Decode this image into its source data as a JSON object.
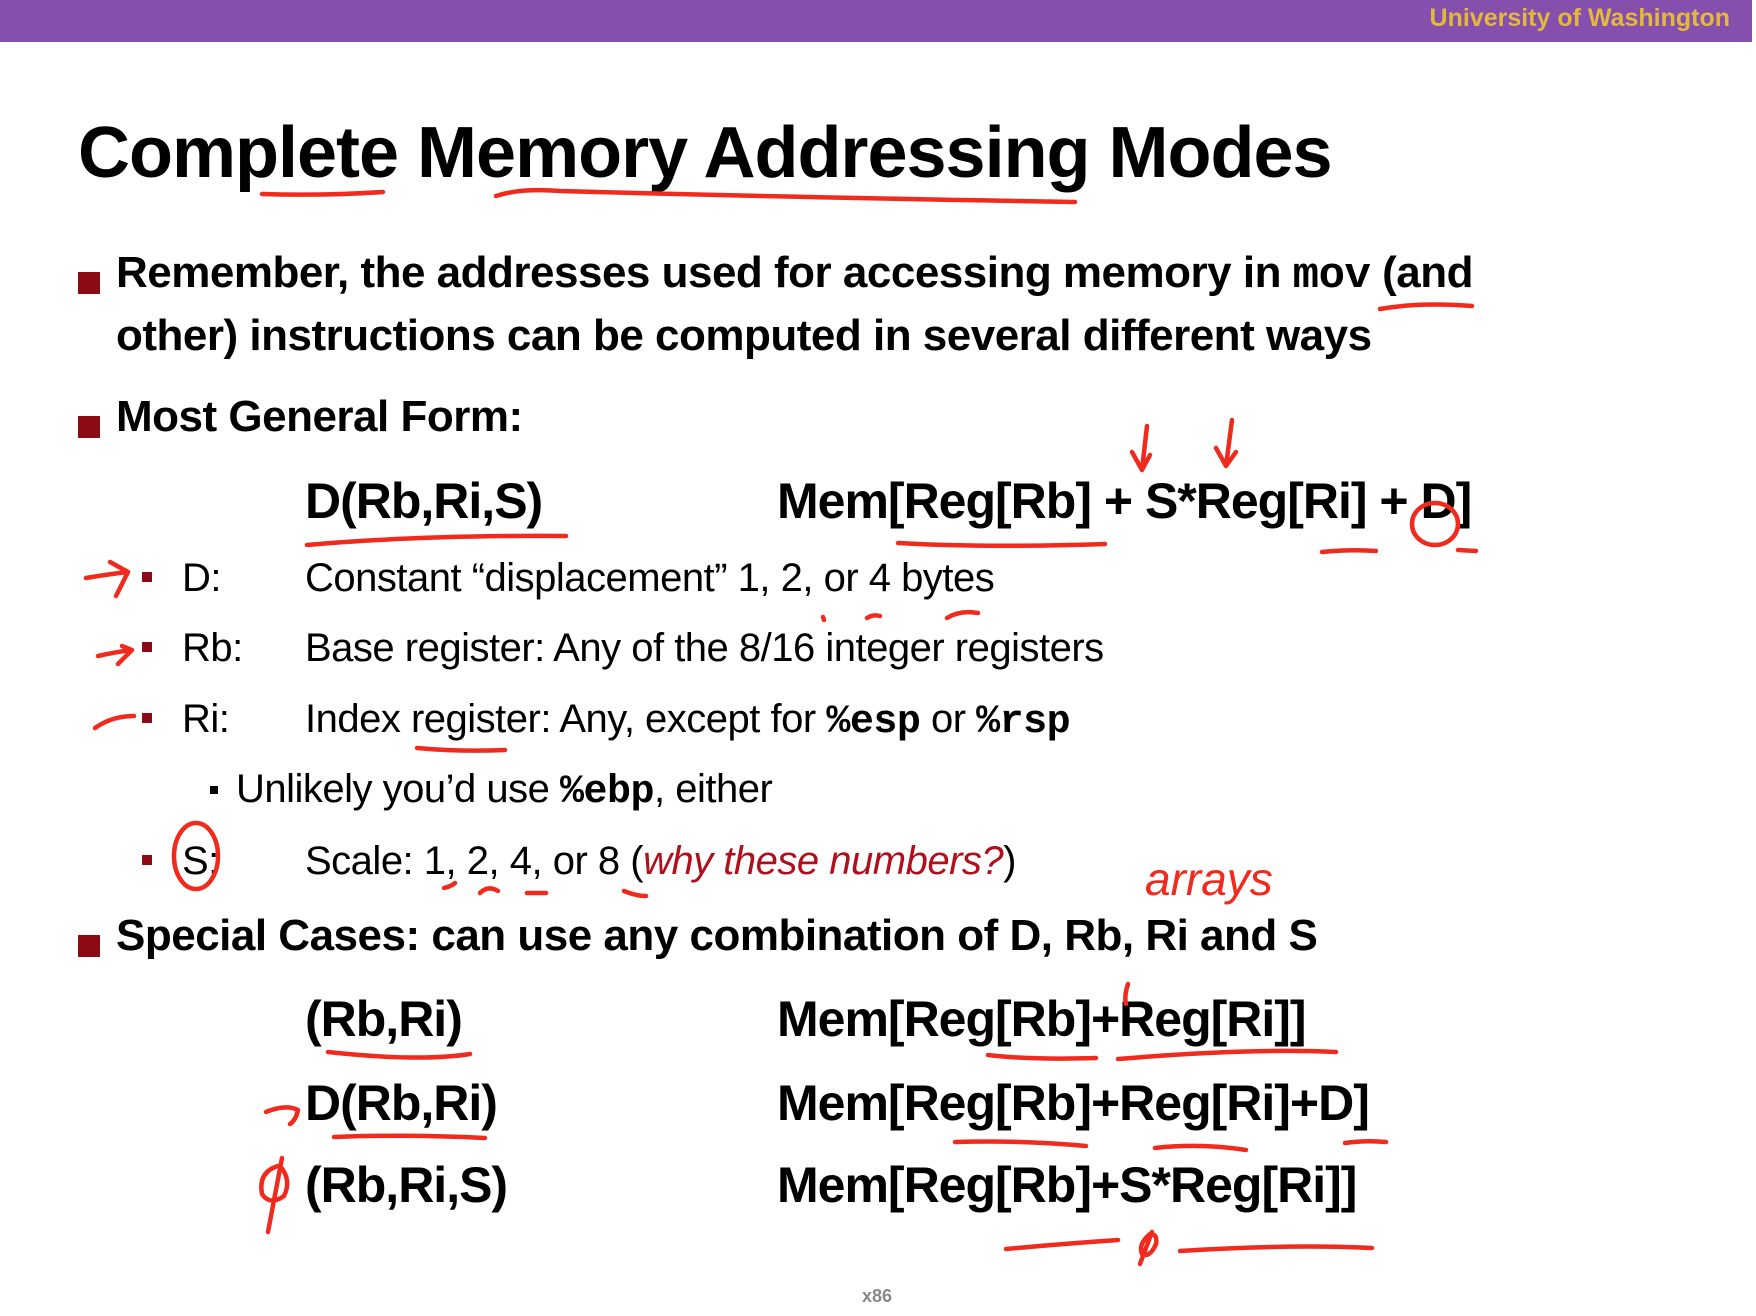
{
  "header": {
    "institution": "University of Washington"
  },
  "slide": {
    "title": "Complete Memory Addressing Modes",
    "bullet1": {
      "line1_pre": "Remember, the addresses used for accessing memory in ",
      "line1_code": "mov",
      "line1_post": " (and",
      "line2": "other) instructions can be computed in several different ways"
    },
    "general": {
      "heading": "Most General Form:",
      "syntax": "D(Rb,Ri,S)",
      "meaning": "Mem[Reg[Rb] + S*Reg[Ri] + D]"
    },
    "components": [
      {
        "label": "D:",
        "desc": "Constant “displacement” 1, 2, or 4 bytes"
      },
      {
        "label": "Rb:",
        "desc": "Base register: Any of the 8/16 integer registers"
      },
      {
        "label": "Ri:",
        "desc_pre": "Index register: Any, except for ",
        "code1": "%esp",
        "mid": " or ",
        "code2": "%rsp"
      },
      {
        "label": "S:",
        "desc_pre": "Scale: 1, 2, 4, or 8 (",
        "desc_italic": "why these numbers?",
        "desc_post": ")"
      }
    ],
    "sub_note": {
      "pre": "Unlikely you’d use ",
      "code": "%ebp",
      "post": ", either"
    },
    "special": {
      "heading": "Special Cases: can use any combination of D, Rb, Ri and S",
      "cases": [
        {
          "syntax": "(Rb,Ri)",
          "meaning": "Mem[Reg[Rb]+Reg[Ri]]"
        },
        {
          "syntax": "D(Rb,Ri)",
          "meaning": "Mem[Reg[Rb]+Reg[Ri]+D]"
        },
        {
          "syntax": "(Rb,Ri,S)",
          "meaning": "Mem[Reg[Rb]+S*Reg[Ri]]"
        }
      ]
    },
    "annotations": {
      "arrays_note": "arrays",
      "null_mark": "ϕ"
    },
    "footer": "x86"
  },
  "colors": {
    "banner": "#854fae",
    "banner_text": "#e3b83c",
    "bullet": "#8b0a14",
    "ink": "#f02a1c",
    "italic_red": "#b0101c"
  }
}
